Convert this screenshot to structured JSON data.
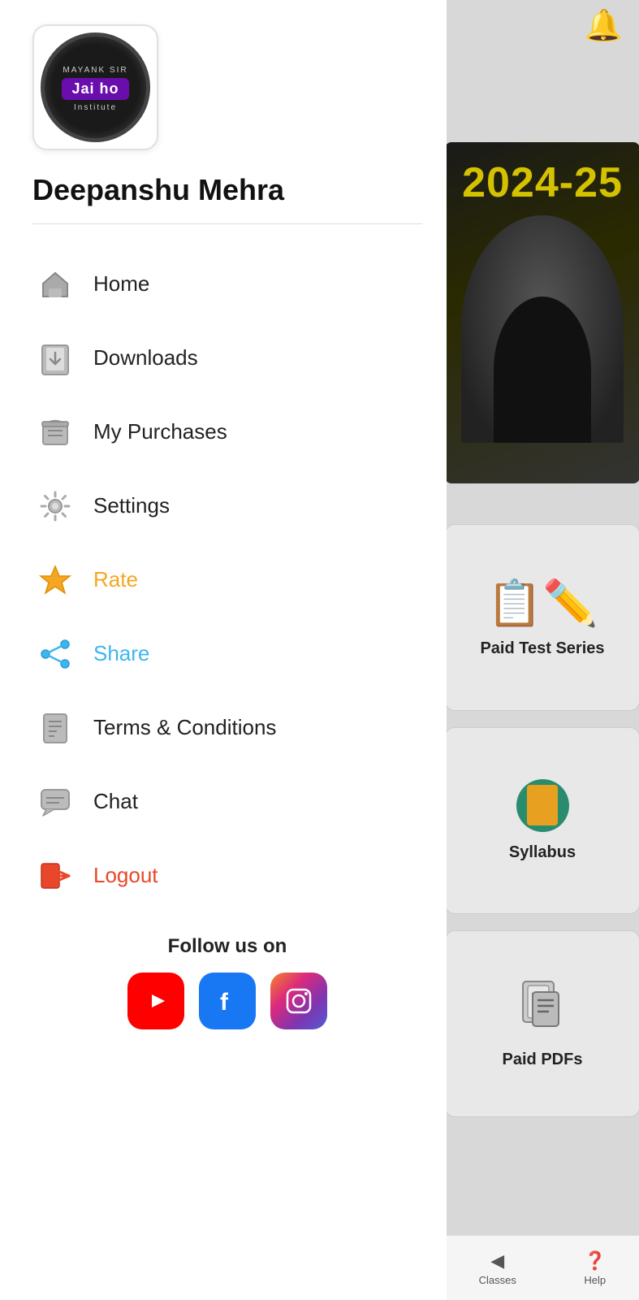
{
  "app": {
    "title": "Jai ho Institute"
  },
  "user": {
    "name": "Deepanshu Mehra"
  },
  "logo": {
    "top_text": "Mayank Sir",
    "name": "Jai ho",
    "bottom_text": "Institute"
  },
  "banner": {
    "year": "2024-25"
  },
  "menu": {
    "items": [
      {
        "id": "home",
        "label": "Home",
        "color": "normal"
      },
      {
        "id": "downloads",
        "label": "Downloads",
        "color": "normal"
      },
      {
        "id": "my-purchases",
        "label": "My Purchases",
        "color": "normal"
      },
      {
        "id": "settings",
        "label": "Settings",
        "color": "normal"
      },
      {
        "id": "rate",
        "label": "Rate",
        "color": "orange"
      },
      {
        "id": "share",
        "label": "Share",
        "color": "blue"
      },
      {
        "id": "terms",
        "label": "Terms & Conditions",
        "color": "normal"
      },
      {
        "id": "chat",
        "label": "Chat",
        "color": "normal"
      },
      {
        "id": "logout",
        "label": "Logout",
        "color": "red"
      }
    ]
  },
  "cards": [
    {
      "id": "paid-test",
      "label": "Paid Test Series"
    },
    {
      "id": "syllabus",
      "label": "Syllabus"
    },
    {
      "id": "paid-pdfs",
      "label": "Paid PDFs"
    }
  ],
  "bottom_bar": [
    {
      "id": "classes",
      "label": "Classes"
    },
    {
      "id": "help",
      "label": "Help"
    }
  ],
  "follow": {
    "label": "Follow us on",
    "platforms": [
      "YouTube",
      "Facebook",
      "Instagram"
    ]
  }
}
